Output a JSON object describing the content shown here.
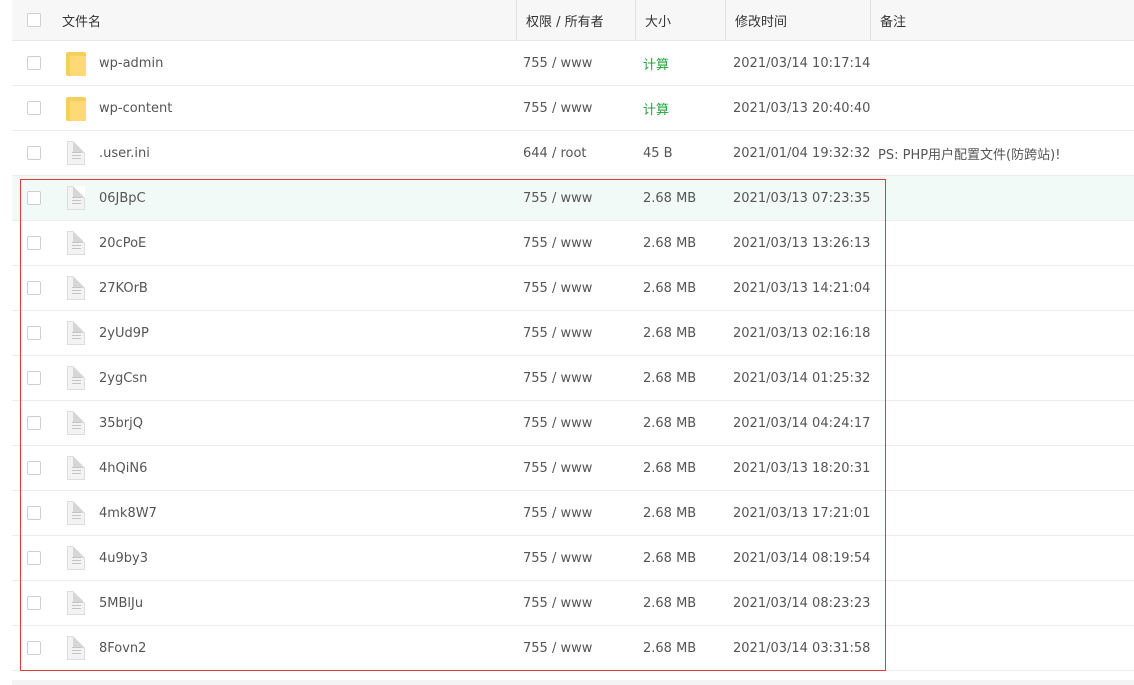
{
  "header": {
    "name": "文件名",
    "perm": "权限 / 所有者",
    "size": "大小",
    "time": "修改时间",
    "note": "备注"
  },
  "rows": [
    {
      "type": "folder",
      "name": "wp-admin",
      "perm": "755 / www",
      "size": "计算",
      "time": "2021/03/14 10:17:14",
      "note": ""
    },
    {
      "type": "folder",
      "name": "wp-content",
      "perm": "755 / www",
      "size": "计算",
      "time": "2021/03/13 20:40:40",
      "note": ""
    },
    {
      "type": "file",
      "name": ".user.ini",
      "perm": "644 / root",
      "size": "45 B",
      "time": "2021/01/04 19:32:32",
      "note": "PS: PHP用户配置文件(防跨站)!"
    },
    {
      "type": "file",
      "name": "06JBpC",
      "perm": "755 / www",
      "size": "2.68 MB",
      "time": "2021/03/13 07:23:35",
      "note": ""
    },
    {
      "type": "file",
      "name": "20cPoE",
      "perm": "755 / www",
      "size": "2.68 MB",
      "time": "2021/03/13 13:26:13",
      "note": ""
    },
    {
      "type": "file",
      "name": "27KOrB",
      "perm": "755 / www",
      "size": "2.68 MB",
      "time": "2021/03/13 14:21:04",
      "note": ""
    },
    {
      "type": "file",
      "name": "2yUd9P",
      "perm": "755 / www",
      "size": "2.68 MB",
      "time": "2021/03/13 02:16:18",
      "note": ""
    },
    {
      "type": "file",
      "name": "2ygCsn",
      "perm": "755 / www",
      "size": "2.68 MB",
      "time": "2021/03/14 01:25:32",
      "note": ""
    },
    {
      "type": "file",
      "name": "35brjQ",
      "perm": "755 / www",
      "size": "2.68 MB",
      "time": "2021/03/14 04:24:17",
      "note": ""
    },
    {
      "type": "file",
      "name": "4hQiN6",
      "perm": "755 / www",
      "size": "2.68 MB",
      "time": "2021/03/13 18:20:31",
      "note": ""
    },
    {
      "type": "file",
      "name": "4mk8W7",
      "perm": "755 / www",
      "size": "2.68 MB",
      "time": "2021/03/13 17:21:01",
      "note": ""
    },
    {
      "type": "file",
      "name": "4u9by3",
      "perm": "755 / www",
      "size": "2.68 MB",
      "time": "2021/03/14 08:19:54",
      "note": ""
    },
    {
      "type": "file",
      "name": "5MBlJu",
      "perm": "755 / www",
      "size": "2.68 MB",
      "time": "2021/03/14 08:23:23",
      "note": ""
    },
    {
      "type": "file",
      "name": "8Fovn2",
      "perm": "755 / www",
      "size": "2.68 MB",
      "time": "2021/03/14 03:31:58",
      "note": ""
    }
  ],
  "colors": {
    "calc_link": "#20a53a",
    "highlight_border": "#e03a3a",
    "hover_row": "#f2faf7"
  },
  "icons": {
    "folder": "folder-icon",
    "file": "file-icon"
  }
}
